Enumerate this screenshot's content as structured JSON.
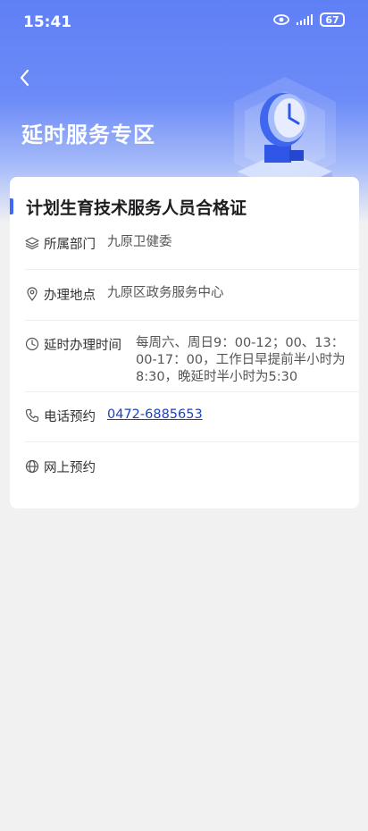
{
  "status_bar": {
    "time": "15:41",
    "battery": "67",
    "icons": [
      "eye-icon",
      "signal-icon",
      "battery-icon"
    ]
  },
  "header": {
    "title": "延时服务专区",
    "back_icon": "chevron-left-icon"
  },
  "card": {
    "title": "计划生育技术服务人员合格证",
    "rows": [
      {
        "icon": "layers-icon",
        "label": "所属部门",
        "value": "九原卫健委"
      },
      {
        "icon": "location-pin-icon",
        "label": "办理地点",
        "value": "九原区政务服务中心"
      },
      {
        "icon": "clock-icon",
        "label": "延时办理时间",
        "value": "每周六、周日9：00-12；00、13：00-17：00，工作日早提前半小时为8:30，晚延时半小时为5:30"
      },
      {
        "icon": "phone-icon",
        "label": "电话预约",
        "value": "0472-6885653"
      },
      {
        "icon": "globe-icon",
        "label": "网上预约",
        "value": ""
      }
    ]
  },
  "colors": {
    "header_blue": "#5f7ff6",
    "accent": "#3d6af1",
    "link": "#1f3fbf"
  }
}
